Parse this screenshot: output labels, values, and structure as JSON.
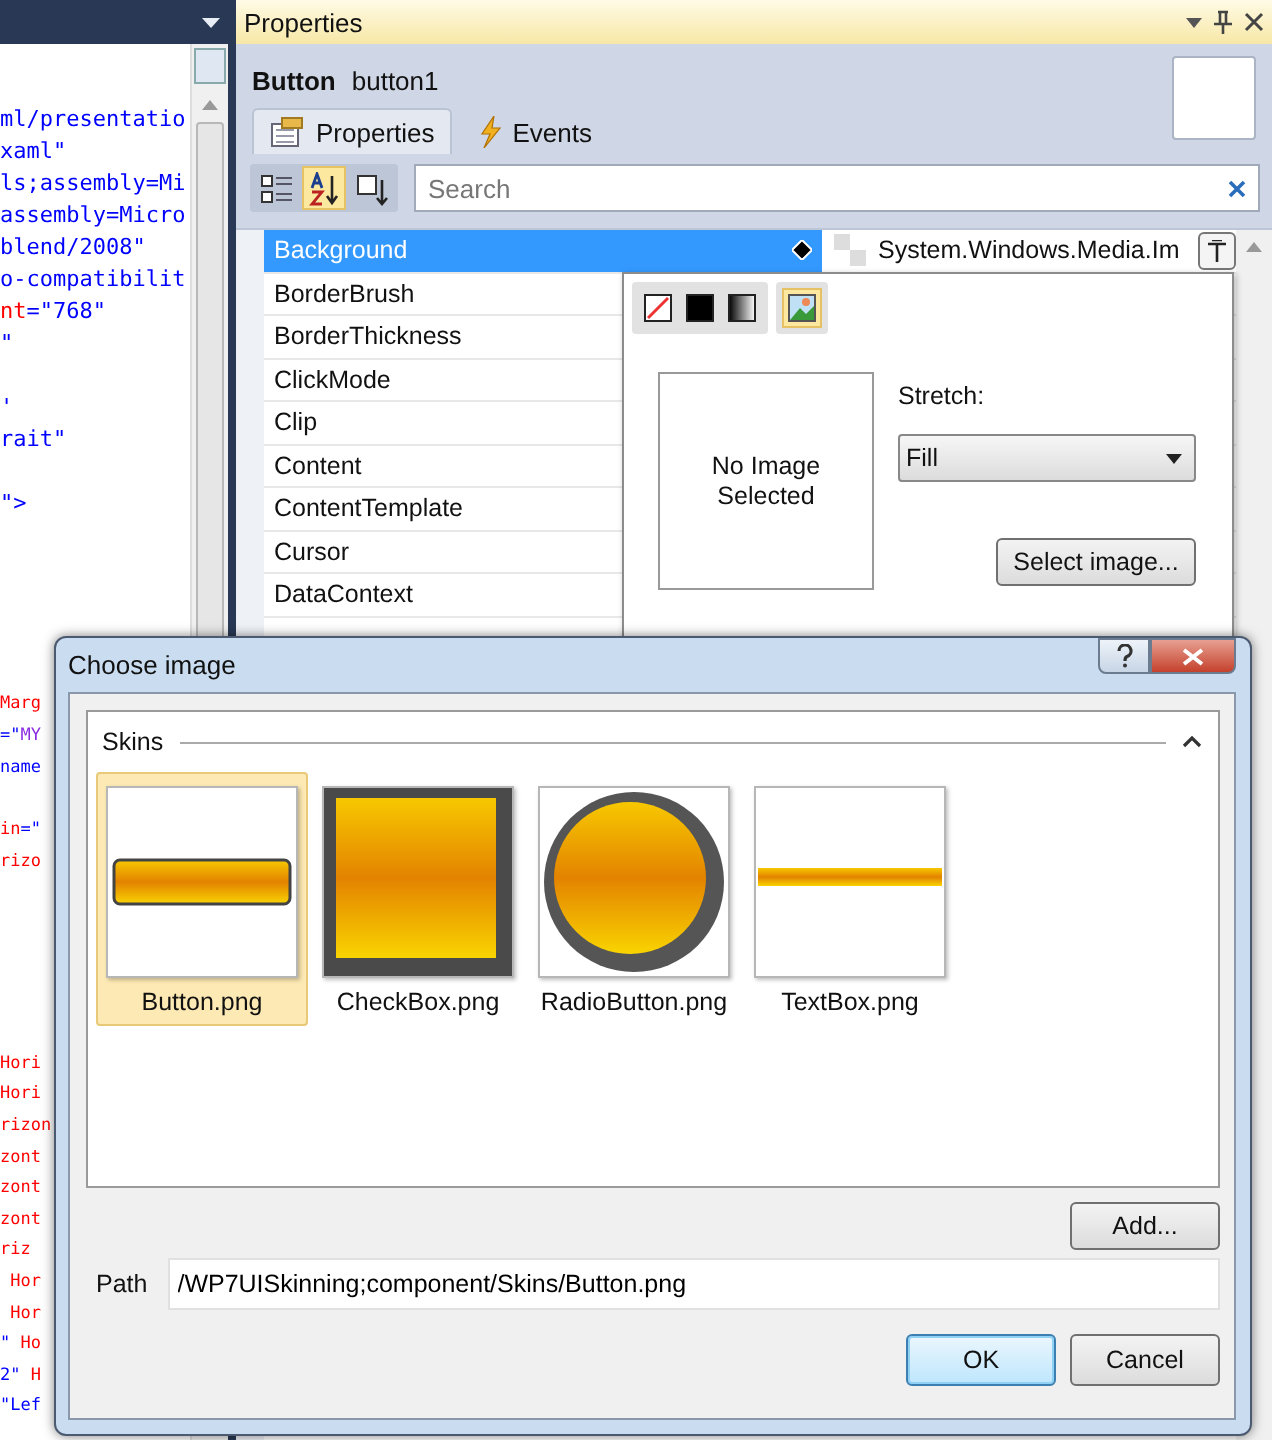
{
  "code_editor": {
    "sections": [
      {
        "blocks": [
          [
            {
              "tokens": [
                {
                  "text": "ml/presentatio",
                  "kind": "value"
                }
              ]
            },
            {
              "tokens": [
                {
                  "text": "xaml\"",
                  "kind": "value"
                }
              ]
            },
            {
              "tokens": [
                {
                  "text": "ls;assembly=Mi",
                  "kind": "value"
                }
              ]
            },
            {
              "tokens": [
                {
                  "text": "assembly=Micro",
                  "kind": "value"
                }
              ]
            },
            {
              "tokens": [
                {
                  "text": "blend/2008\"",
                  "kind": "value"
                }
              ]
            },
            {
              "tokens": [
                {
                  "text": "o-compatibilit",
                  "kind": "value"
                }
              ]
            },
            {
              "tokens": [
                {
                  "text": "nt",
                  "kind": "attr"
                },
                {
                  "text": "=\"768\"",
                  "kind": "value"
                }
              ]
            },
            {
              "tokens": [
                {
                  "text": "\"",
                  "kind": "value"
                }
              ]
            }
          ],
          [
            {
              "tokens": [
                {
                  "text": "'",
                  "kind": "value"
                }
              ]
            },
            {
              "tokens": [
                {
                  "text": "rait\"",
                  "kind": "value"
                }
              ]
            }
          ],
          [
            {
              "tokens": [
                {
                  "text": "\">",
                  "kind": "value"
                }
              ]
            }
          ]
        ]
      },
      {
        "blocks": [
          [
            {
              "tokens": [
                {
                  "text": "Marg",
                  "kind": "attr"
                }
              ]
            },
            {
              "tokens": [
                {
                  "text": "=\"",
                  "kind": "value"
                },
                {
                  "text": "MY",
                  "kind": "ref"
                }
              ]
            },
            {
              "tokens": [
                {
                  "text": "name",
                  "kind": "value"
                }
              ]
            }
          ],
          [
            {
              "tokens": [
                {
                  "text": "in",
                  "kind": "attr"
                },
                {
                  "text": "=\"",
                  "kind": "value"
                }
              ]
            },
            {
              "tokens": [
                {
                  "text": "rizo",
                  "kind": "attr"
                }
              ]
            }
          ]
        ]
      },
      {
        "blocks": [
          [
            {
              "tokens": [
                {
                  "text": "Hori",
                  "kind": "attr"
                }
              ]
            },
            {
              "tokens": [
                {
                  "text": "Hori",
                  "kind": "attr"
                }
              ]
            },
            {
              "tokens": [
                {
                  "text": "rizon",
                  "kind": "attr"
                }
              ]
            },
            {
              "tokens": [
                {
                  "text": "zont",
                  "kind": "attr"
                }
              ]
            },
            {
              "tokens": [
                {
                  "text": "zont",
                  "kind": "attr"
                }
              ]
            },
            {
              "tokens": [
                {
                  "text": "zont",
                  "kind": "attr"
                }
              ]
            },
            {
              "tokens": [
                {
                  "text": "riz",
                  "kind": "attr"
                }
              ]
            },
            {
              "tokens": [
                {
                  "text": " Hor",
                  "kind": "attr"
                }
              ]
            },
            {
              "tokens": [
                {
                  "text": " Hor",
                  "kind": "attr"
                }
              ]
            },
            {
              "tokens": [
                {
                  "text": "\"",
                  "kind": "value"
                },
                {
                  "text": " Ho",
                  "kind": "attr"
                }
              ]
            },
            {
              "tokens": [
                {
                  "text": "2\"",
                  "kind": "value"
                },
                {
                  "text": " H",
                  "kind": "attr"
                }
              ]
            },
            {
              "tokens": [
                {
                  "text": "\"Lef",
                  "kind": "value"
                }
              ]
            }
          ]
        ]
      }
    ]
  },
  "properties_panel": {
    "title": "Properties",
    "element_type": "Button",
    "element_name": "button1",
    "tabs": [
      {
        "label": "Properties",
        "kind": "properties",
        "selected": true
      },
      {
        "label": "Events",
        "kind": "events",
        "selected": false
      }
    ],
    "view_buttons": [
      {
        "kind": "categorized",
        "selected": false
      },
      {
        "kind": "alphabetical",
        "selected": true
      },
      {
        "kind": "filter",
        "selected": false
      }
    ],
    "search": {
      "placeholder": "Search"
    },
    "properties": [
      {
        "name": "Background",
        "selected": true,
        "value": "System.Windows.Media.Im"
      },
      {
        "name": "BorderBrush",
        "selected": false
      },
      {
        "name": "BorderThickness",
        "selected": false
      },
      {
        "name": "ClickMode",
        "selected": false
      },
      {
        "name": "Clip",
        "selected": false
      },
      {
        "name": "Content",
        "selected": false
      },
      {
        "name": "ContentTemplate",
        "selected": false
      },
      {
        "name": "Cursor",
        "selected": false
      },
      {
        "name": "DataContext",
        "selected": false
      }
    ]
  },
  "brush_editor": {
    "brush_types": [
      {
        "kind": "none",
        "selected": false
      },
      {
        "kind": "solid",
        "selected": false
      },
      {
        "kind": "gradient",
        "selected": false
      },
      {
        "kind": "image",
        "selected": true
      }
    ],
    "image_preview": "No Image Selected",
    "stretch_label": "Stretch:",
    "stretch_value": "Fill",
    "select_button": "Select image..."
  },
  "choose_image_dialog": {
    "title": "Choose image",
    "group": {
      "label": "Skins",
      "expanded": true,
      "items": [
        {
          "label": "Button.png",
          "kind": "bar",
          "selected": true
        },
        {
          "label": "CheckBox.png",
          "kind": "square",
          "selected": false
        },
        {
          "label": "RadioButton.png",
          "kind": "circle",
          "selected": false
        },
        {
          "label": "TextBox.png",
          "kind": "line",
          "selected": false
        }
      ]
    },
    "add_button": "Add...",
    "path_label": "Path",
    "path_value": "/WP7UISkinning;component/Skins/Button.png",
    "buttons": [
      {
        "label": "OK",
        "default": true
      },
      {
        "label": "Cancel",
        "default": false
      }
    ]
  }
}
